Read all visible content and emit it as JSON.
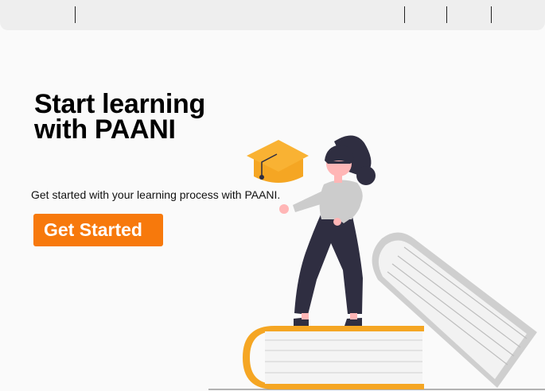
{
  "hero": {
    "title_line1": "Start learning",
    "title_line2": "with PAANI",
    "subtitle": "Get started with your learning process with PAANI.",
    "cta_label": "Get Started"
  },
  "colors": {
    "accent": "#f7790c",
    "cap": "#f9a825",
    "book_cover_orange": "#f5a623",
    "book_cover_gray": "#cfcfcf",
    "figure_dark": "#2f2e41",
    "skin": "#ffb6b6",
    "shirt": "#cccccc"
  }
}
